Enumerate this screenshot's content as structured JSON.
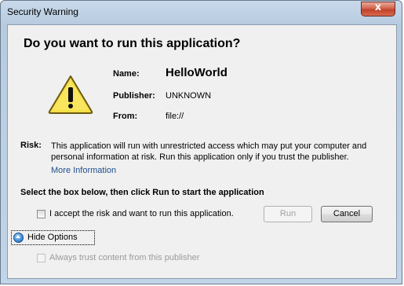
{
  "window": {
    "title": "Security Warning",
    "close_glyph": "x"
  },
  "dialog": {
    "heading": "Do you want to run this application?",
    "icon": "warning-triangle-icon",
    "name_label": "Name:",
    "name_value": "HelloWorld",
    "publisher_label": "Publisher:",
    "publisher_value": "UNKNOWN",
    "from_label": "From:",
    "from_value": "file://",
    "risk_label": "Risk:",
    "risk_text": "This application will run with unrestricted access which may put your computer and personal information at risk. Run this application only if you trust the publisher.",
    "more_info": "More Information",
    "instruction": "Select the box below, then click Run to start the application",
    "accept_label": "I accept the risk and want to run this application.",
    "accept_checked": false,
    "run_label": "Run",
    "cancel_label": "Cancel",
    "hide_options_label": "Hide Options",
    "always_trust_label": "Always trust content from this publisher",
    "always_trust_checked": false
  },
  "colors": {
    "link": "#1e4e8c",
    "warning_fill": "#f4e04a",
    "close_button": "#c0412a"
  }
}
